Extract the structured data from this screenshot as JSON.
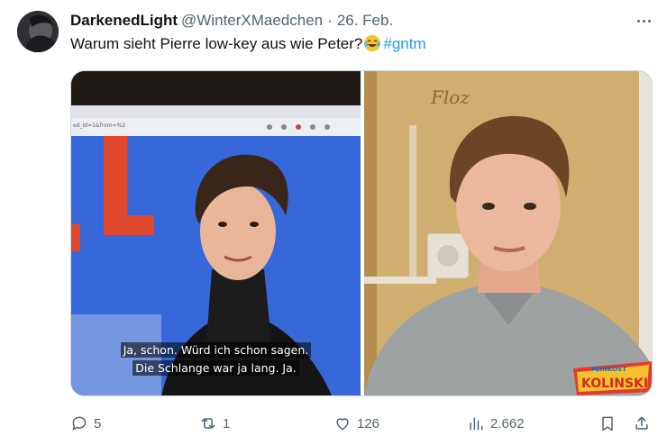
{
  "tweet": {
    "display_name": "DarkenedLight",
    "handle": "@WinterXMaedchen",
    "separator": "·",
    "date": "26. Feb.",
    "text": "Warum sieht Pierre low-key aus wie Peter?",
    "hashtag": "#gntm"
  },
  "media": {
    "left": {
      "subtitle_line1": "Ja, schon. Würd ich schon sagen.",
      "subtitle_line2": "Die Schlange war ja lang. Ja.",
      "browser_url": "ed_id=1&from=%2"
    },
    "right": {
      "badge_top": "FEINKOST",
      "badge_main": "KOLINSKI",
      "board_scribble": "Floz"
    }
  },
  "actions": {
    "replies": "5",
    "reposts": "1",
    "likes": "126",
    "views": "2.662"
  },
  "colors": {
    "link": "#1d9bf0",
    "secondary_text": "#536471",
    "primary_text": "#0f1419"
  }
}
